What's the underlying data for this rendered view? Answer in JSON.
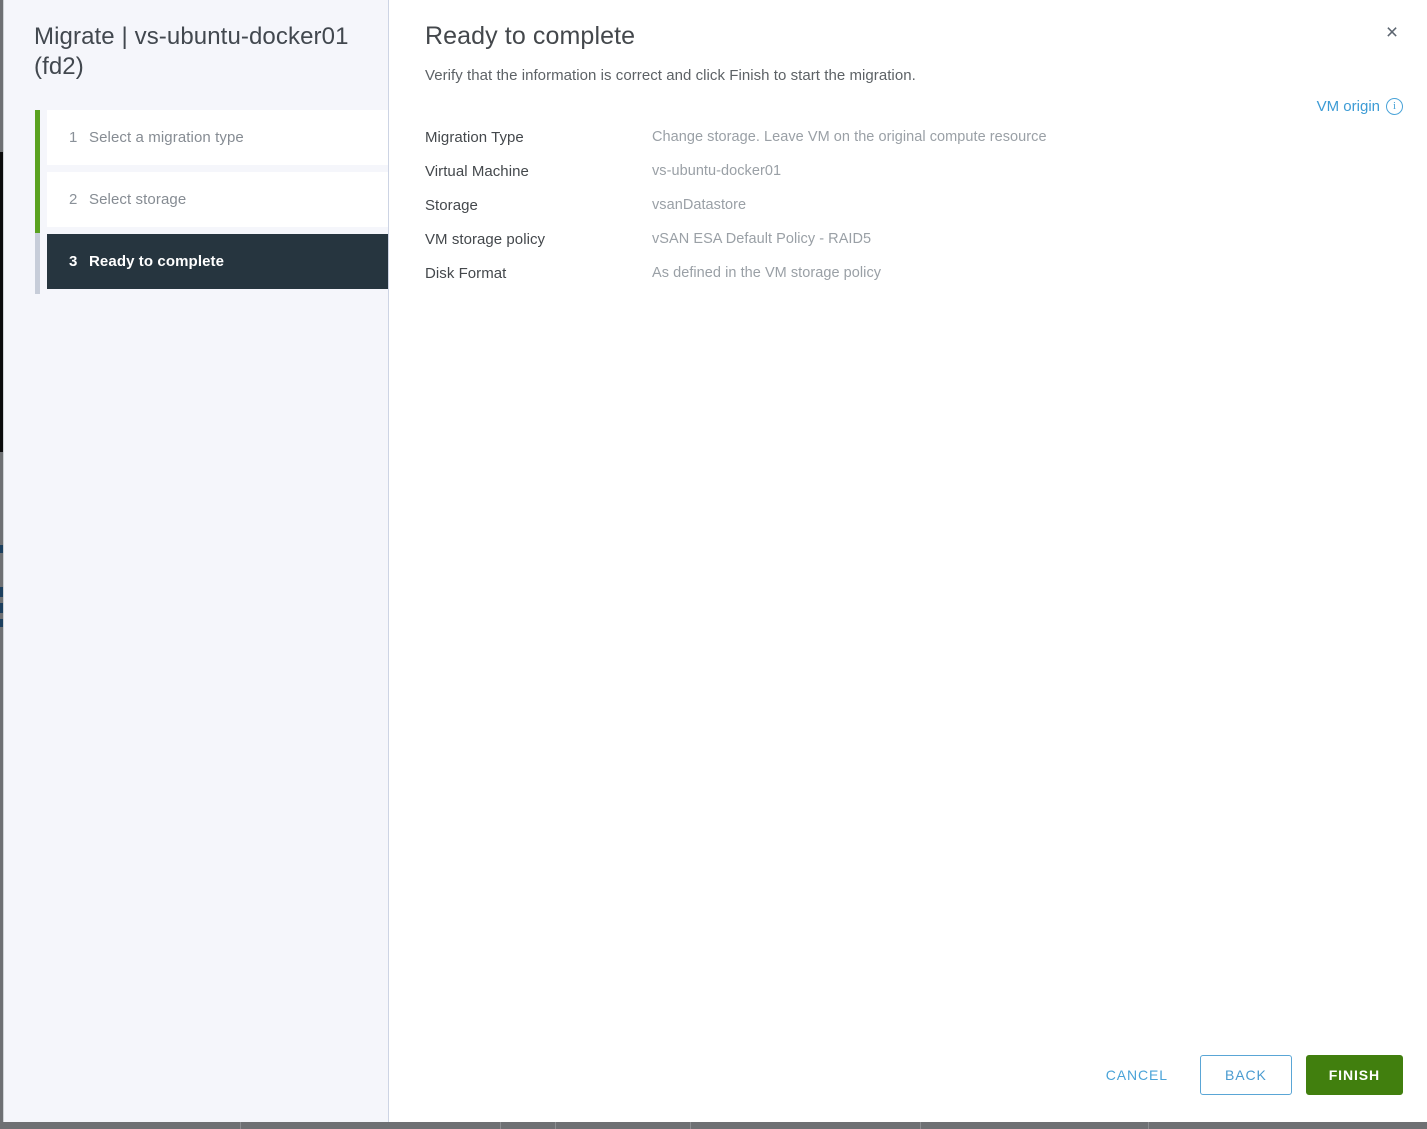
{
  "window": {
    "title": "Migrate | vs-ubuntu-docker01 (fd2)"
  },
  "sidebar": {
    "steps": [
      {
        "num": "1",
        "label": "Select a migration type",
        "state": "completed"
      },
      {
        "num": "2",
        "label": "Select storage",
        "state": "completed"
      },
      {
        "num": "3",
        "label": "Ready to complete",
        "state": "active"
      }
    ]
  },
  "main": {
    "page_title": "Ready to complete",
    "subtitle": "Verify that the information is correct and click Finish to start the migration.",
    "close_label": "×",
    "vm_origin": {
      "label": "VM origin",
      "icon": "info-icon",
      "icon_glyph": "i"
    },
    "summary": [
      {
        "label": "Migration Type",
        "value": "Change storage. Leave VM on the original compute resource"
      },
      {
        "label": "Virtual Machine",
        "value": "vs-ubuntu-docker01"
      },
      {
        "label": "Storage",
        "value": "vsanDatastore"
      },
      {
        "label": "VM storage policy",
        "value": "vSAN ESA Default Policy - RAID5"
      },
      {
        "label": "Disk Format",
        "value": "As defined in the VM storage policy"
      }
    ]
  },
  "footer": {
    "cancel_label": "CANCEL",
    "back_label": "BACK",
    "finish_label": "FINISH"
  },
  "colors": {
    "accent_link": "#3c9bd5",
    "finish_green": "#417f0e",
    "progress_green": "#5aa220",
    "active_step_bg": "#26353f",
    "sidebar_bg": "#f5f6fb"
  }
}
